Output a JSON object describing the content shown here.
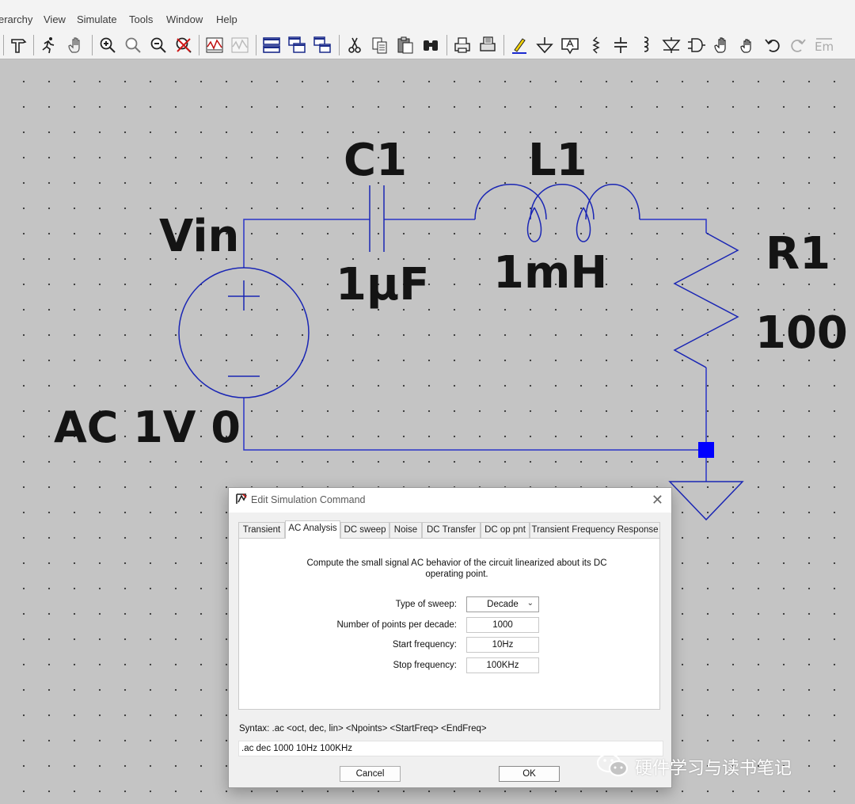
{
  "menubar": {
    "items": [
      "erarchy",
      "View",
      "Simulate",
      "Tools",
      "Window",
      "Help"
    ]
  },
  "toolbar": {
    "icons": [
      "hammer-icon",
      "run-icon",
      "hand-icon",
      "zoom-in-icon",
      "zoom-out-icon",
      "zoom-fit-icon",
      "zoom-cancel-icon",
      "plot-icon",
      "plot-disabled-icon",
      "tile-horizontal-icon",
      "cascade-icon",
      "tile-vertical-icon",
      "cut-icon",
      "copy-icon",
      "paste-icon",
      "find-icon",
      "print-icon",
      "print-setup-icon",
      "draw-wire-icon",
      "ground-icon",
      "label-net-icon",
      "resistor-icon",
      "capacitor-icon",
      "inductor-icon",
      "diode-icon",
      "component-icon",
      "move-icon",
      "drag-icon",
      "undo-icon",
      "redo-icon",
      "text-icon"
    ]
  },
  "schematic": {
    "vin_name": "Vin",
    "vin_value": "AC 1V 0",
    "c1_name": "C1",
    "c1_value": "1μF",
    "l1_name": "L1",
    "l1_value": "1mH",
    "r1_name": "R1",
    "r1_value": "100",
    "colors": {
      "wire": "#2a35c8",
      "junction": "#0000ff",
      "component": "#1a26b4",
      "background": "#c4c4c4"
    }
  },
  "dialog": {
    "title": "Edit Simulation Command",
    "tabs": [
      "Transient",
      "AC Analysis",
      "DC sweep",
      "Noise",
      "DC Transfer",
      "DC op pnt",
      "Transient Frequency Response"
    ],
    "active_tab": "AC Analysis",
    "description": "Compute the small signal AC behavior of the circuit linearized about its DC operating point.",
    "fields": {
      "sweep_type": {
        "label": "Type of sweep:",
        "value": "Decade"
      },
      "points": {
        "label": "Number of points per decade:",
        "value": "1000"
      },
      "start": {
        "label": "Start frequency:",
        "value": "10Hz"
      },
      "stop": {
        "label": "Stop frequency:",
        "value": "100KHz"
      }
    },
    "syntax": "Syntax:  .ac <oct, dec, lin> <Npoints> <StartFreq> <EndFreq>",
    "command": ".ac dec 1000 10Hz 100KHz",
    "cancel_label": "Cancel",
    "ok_label": "OK"
  },
  "watermark": {
    "text": "硬件学习与读书笔记"
  }
}
